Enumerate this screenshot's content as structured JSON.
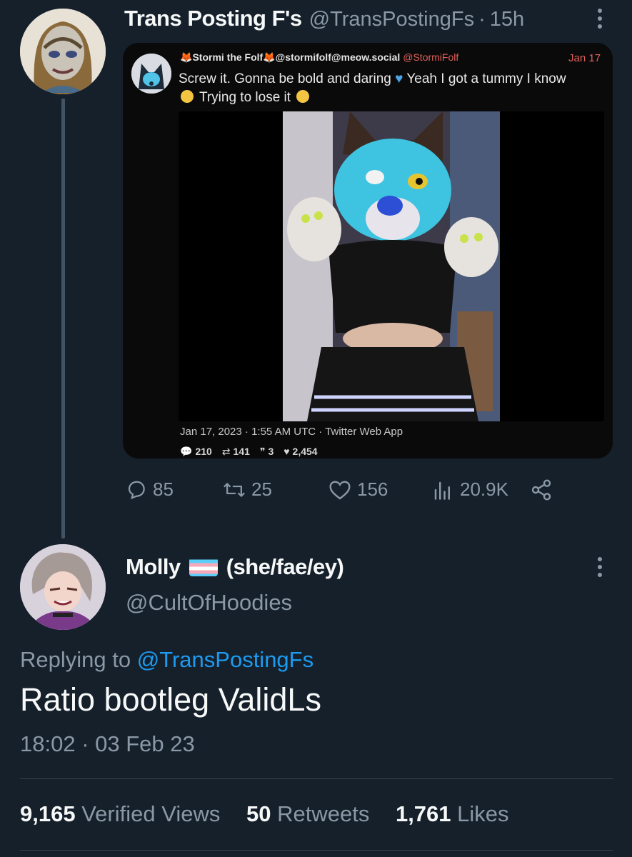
{
  "tweet1": {
    "name": "Trans Posting F's",
    "handle": "@TransPostingFs",
    "time": "15h",
    "actions": {
      "replies": "85",
      "retweets": "25",
      "likes": "156",
      "views": "20.9K"
    }
  },
  "quoted": {
    "name": "Stormi the Folf",
    "name_suffix": "@stormifolf@meow.social",
    "handle": "@StormiFolf",
    "date": "Jan 17",
    "text_part1": "Screw it. Gonna be bold and daring",
    "text_part2": "Yeah I got a tummy I know",
    "text_part3": "Trying to lose it",
    "meta": "Jan 17, 2023 · 1:55 AM UTC · Twitter Web App",
    "stats": {
      "replies": "210",
      "retweets": "141",
      "quotes": "3",
      "likes": "2,454"
    }
  },
  "reply": {
    "name": "Molly",
    "pronouns": "(she/fae/ey)",
    "handle": "@CultOfHoodies",
    "replying_prefix": "Replying to",
    "replying_to": "@TransPostingFs",
    "text": "Ratio bootleg ValidLs",
    "timestamp": "18:02 · 03 Feb 23",
    "views_count": "9,165",
    "views_label": "Verified Views",
    "retweets_count": "50",
    "retweets_label": "Retweets",
    "likes_count": "1,761",
    "likes_label": "Likes"
  },
  "colors": {
    "background": "#15202b",
    "secondary_text": "#8b98a5",
    "link": "#1d9bf0",
    "quoted_accent": "#e0605a"
  }
}
